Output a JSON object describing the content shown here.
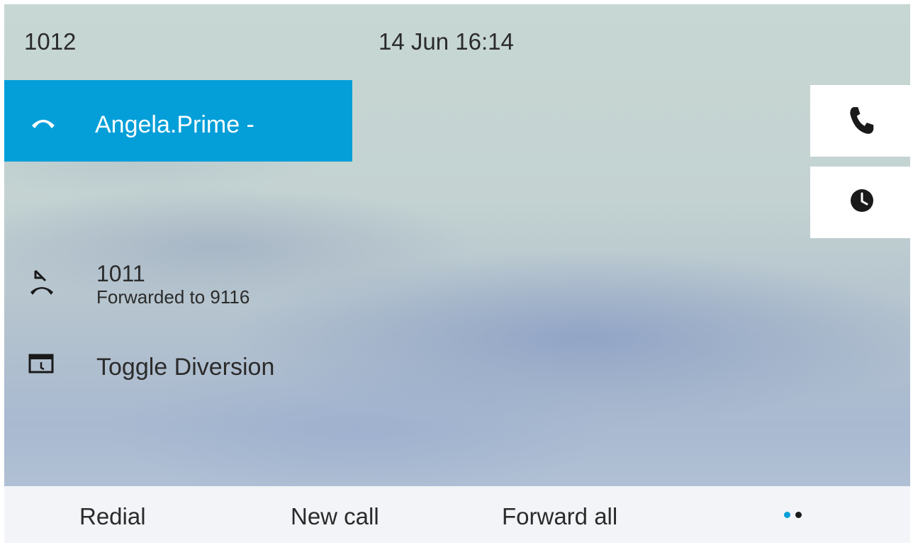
{
  "status_bar": {
    "extension": "1012",
    "datetime": "14 Jun 16:14"
  },
  "line_key": {
    "label": "Angela.Prime -",
    "icon": "handset-down-icon",
    "background": "#049fd9"
  },
  "side_buttons": [
    {
      "icon": "phone-icon"
    },
    {
      "icon": "clock-icon"
    }
  ],
  "call_forward": {
    "number": "1011",
    "detail": "Forwarded to 9116",
    "icon": "call-forward-icon"
  },
  "toggle_item": {
    "label": "Toggle Diversion",
    "icon": "service-window-icon"
  },
  "softkeys": {
    "redial": "Redial",
    "new_call": "New call",
    "forward_all": "Forward all"
  },
  "page_indicator": {
    "active_color": "#049fd9",
    "inactive_color": "#1a1a1a",
    "current_page": 1,
    "total_pages": 2
  }
}
